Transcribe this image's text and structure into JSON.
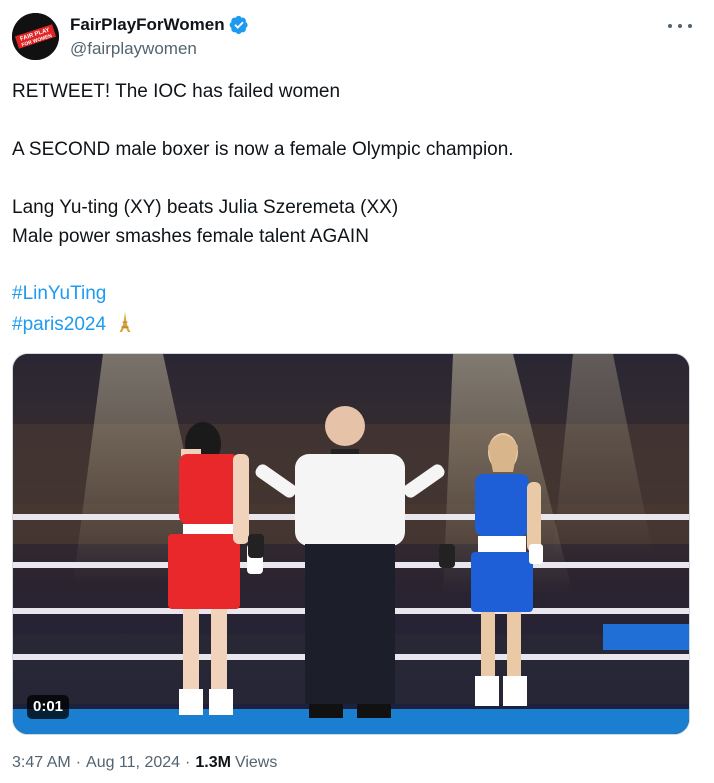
{
  "author": {
    "display_name": "FairPlayForWomen",
    "handle": "@fairplaywomen",
    "avatar_text_1": "FAIR PLAY",
    "avatar_text_2": "FOR WOMEN",
    "verified_icon": "verified-badge-icon"
  },
  "tweet": {
    "line1": "RETWEET!  The IOC has failed women",
    "line2": "A SECOND male boxer is now a female Olympic champion.",
    "line3": "Lang Yu-ting (XY) beats Julia Szeremeta (XX)",
    "line4": "Male power smashes female talent AGAIN",
    "hashtag1": "#LinYuTing",
    "hashtag2": "#paris2024",
    "emoji": "eiffel-tower-icon"
  },
  "media": {
    "video_time": "0:01",
    "colors": {
      "red_corner": "#e8282b",
      "blue_corner": "#1e5ed6",
      "ring_floor": "#1a7fd0"
    }
  },
  "footer": {
    "time": "3:47 AM",
    "date": "Aug 11, 2024",
    "views_count": "1.3M",
    "views_label": "Views",
    "separator": "·"
  },
  "colors": {
    "accent": "#1d9bf0",
    "muted": "#536471",
    "text": "#0f1419"
  }
}
